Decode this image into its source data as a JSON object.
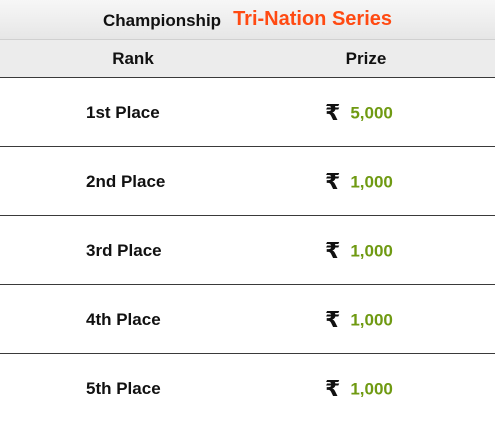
{
  "header": {
    "label": "Championship",
    "name": "Tri-Nation Series"
  },
  "columns": {
    "rank": "Rank",
    "prize": "Prize"
  },
  "currency_symbol": "₹",
  "rows": [
    {
      "rank": "1st Place",
      "amount": "5,000"
    },
    {
      "rank": "2nd Place",
      "amount": "1,000"
    },
    {
      "rank": "3rd Place",
      "amount": "1,000"
    },
    {
      "rank": "4th Place",
      "amount": "1,000"
    },
    {
      "rank": "5th Place",
      "amount": "1,000"
    }
  ],
  "colors": {
    "title_accent": "#ff4a12",
    "amount": "#6f9a12"
  }
}
